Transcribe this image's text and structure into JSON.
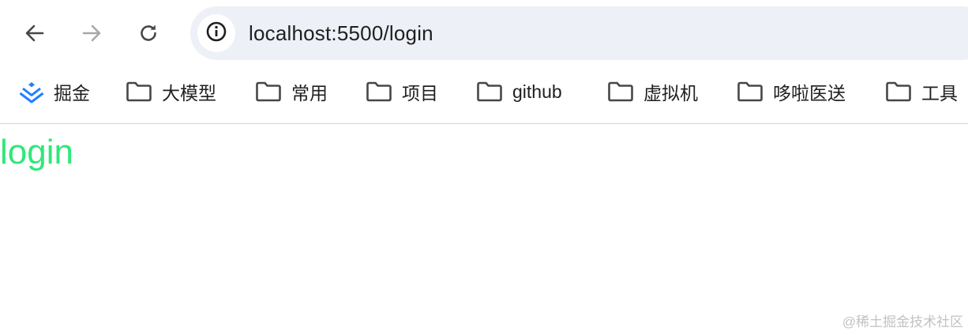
{
  "toolbar": {
    "back_icon": "arrow-left-icon",
    "forward_icon": "arrow-right-icon",
    "reload_icon": "reload-icon",
    "site_info_icon": "info-icon",
    "url": "localhost:5500/login",
    "omnibox_bg": "#eef0f7"
  },
  "bookmarks": [
    {
      "label": "掘金",
      "icon": "juejin-logo-icon"
    },
    {
      "label": "大模型",
      "icon": "folder-icon"
    },
    {
      "label": "常用",
      "icon": "folder-icon"
    },
    {
      "label": "项目",
      "icon": "folder-icon"
    },
    {
      "label": "github",
      "icon": "folder-icon"
    },
    {
      "label": "虚拟机",
      "icon": "folder-icon"
    },
    {
      "label": "哆啦医送",
      "icon": "folder-icon"
    },
    {
      "label": "工具",
      "icon": "folder-icon"
    }
  ],
  "page": {
    "heading": "login",
    "heading_color": "#2ee87a",
    "watermark": "@稀土掘金技术社区"
  }
}
